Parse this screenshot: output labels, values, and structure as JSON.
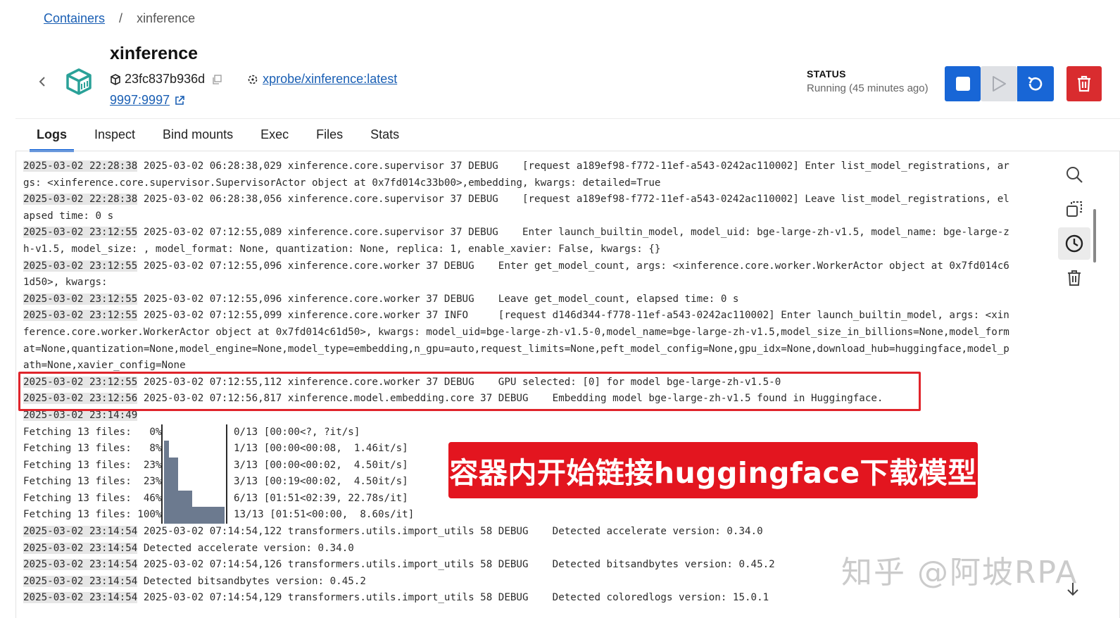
{
  "breadcrumb": {
    "parent": "Containers",
    "separator": "/",
    "current": "xinference"
  },
  "container": {
    "name": "xinference",
    "id": "23fc837b936d",
    "image": "xprobe/xinference:latest",
    "port": "9997:9997"
  },
  "status": {
    "label": "STATUS",
    "value": "Running (45 minutes ago)"
  },
  "tabs": [
    "Logs",
    "Inspect",
    "Bind mounts",
    "Exec",
    "Files",
    "Stats"
  ],
  "active_tab": "Logs",
  "colors": {
    "accent": "#1866d6",
    "danger": "#d92c2f",
    "highlight": "#e0242b",
    "banner": "#e3151f"
  },
  "icons": [
    "chevron-left-icon",
    "container-box-icon",
    "cube-icon",
    "copy-icon",
    "image-icon",
    "external-link-icon",
    "stop-icon",
    "play-icon",
    "restart-icon",
    "trash-icon",
    "search-icon",
    "copy-logs-icon",
    "clock-icon",
    "clear-logs-icon",
    "arrow-down-icon"
  ],
  "logs": [
    {
      "ts": "2025-03-02 22:28:38",
      "text": " 2025-03-02 06:28:38,029 xinference.core.supervisor 37 DEBUG    [request a189ef98-f772-11ef-a543-0242ac110002] Enter list_model_registrations, ar"
    },
    {
      "ts": "",
      "text": "gs: <xinference.core.supervisor.SupervisorActor object at 0x7fd014c33b00>,embedding, kwargs: detailed=True"
    },
    {
      "ts": "2025-03-02 22:28:38",
      "text": " 2025-03-02 06:28:38,056 xinference.core.supervisor 37 DEBUG    [request a189ef98-f772-11ef-a543-0242ac110002] Leave list_model_registrations, el"
    },
    {
      "ts": "",
      "text": "apsed time: 0 s"
    },
    {
      "ts": "2025-03-02 23:12:55",
      "text": " 2025-03-02 07:12:55,089 xinference.core.supervisor 37 DEBUG    Enter launch_builtin_model, model_uid: bge-large-zh-v1.5, model_name: bge-large-z"
    },
    {
      "ts": "",
      "text": "h-v1.5, model_size: , model_format: None, quantization: None, replica: 1, enable_xavier: False, kwargs: {}"
    },
    {
      "ts": "2025-03-02 23:12:55",
      "text": " 2025-03-02 07:12:55,096 xinference.core.worker 37 DEBUG    Enter get_model_count, args: <xinference.core.worker.WorkerActor object at 0x7fd014c6"
    },
    {
      "ts": "",
      "text": "1d50>, kwargs:"
    },
    {
      "ts": "2025-03-02 23:12:55",
      "text": " 2025-03-02 07:12:55,096 xinference.core.worker 37 DEBUG    Leave get_model_count, elapsed time: 0 s"
    },
    {
      "ts": "2025-03-02 23:12:55",
      "text": " 2025-03-02 07:12:55,099 xinference.core.worker 37 INFO     [request d146d344-f778-11ef-a543-0242ac110002] Enter launch_builtin_model, args: <xin"
    },
    {
      "ts": "",
      "text": "ference.core.worker.WorkerActor object at 0x7fd014c61d50>, kwargs: model_uid=bge-large-zh-v1.5-0,model_name=bge-large-zh-v1.5,model_size_in_billions=None,model_form"
    },
    {
      "ts": "",
      "text": "at=None,quantization=None,model_engine=None,model_type=embedding,n_gpu=auto,request_limits=None,peft_model_config=None,gpu_idx=None,download_hub=huggingface,model_p"
    },
    {
      "ts": "",
      "text": "ath=None,xavier_config=None"
    },
    {
      "ts": "2025-03-02 23:12:55",
      "text": " 2025-03-02 07:12:55,112 xinference.core.worker 37 DEBUG    GPU selected: [0] for model bge-large-zh-v1.5-0"
    },
    {
      "ts": "2025-03-02 23:12:56",
      "text": " 2025-03-02 07:12:56,817 xinference.model.embedding.core 37 DEBUG    Embedding model bge-large-zh-v1.5 found in Huggingface."
    },
    {
      "ts": "2025-03-02 23:14:49",
      "text": ""
    }
  ],
  "progress": [
    {
      "label": "Fetching 13 files:   0%",
      "fraction": 0.0,
      "tail": " 0/13 [00:00<?, ?it/s]"
    },
    {
      "label": "Fetching 13 files:   8%",
      "fraction": 0.08,
      "tail": " 1/13 [00:00<00:08,  1.46it/s]"
    },
    {
      "label": "Fetching 13 files:  23%",
      "fraction": 0.23,
      "tail": " 3/13 [00:00<00:02,  4.50it/s]"
    },
    {
      "label": "Fetching 13 files:  23%",
      "fraction": 0.23,
      "tail": " 3/13 [00:19<00:02,  4.50it/s]"
    },
    {
      "label": "Fetching 13 files:  46%",
      "fraction": 0.46,
      "tail": " 6/13 [01:51<02:39, 22.78s/it]"
    },
    {
      "label": "Fetching 13 files: 100%",
      "fraction": 1.0,
      "tail": " 13/13 [01:51<00:00,  8.60s/it]"
    }
  ],
  "logs_after": [
    {
      "ts": "2025-03-02 23:14:54",
      "text": " 2025-03-02 07:14:54,122 transformers.utils.import_utils 58 DEBUG    Detected accelerate version: 0.34.0"
    },
    {
      "ts": "2025-03-02 23:14:54",
      "text": " Detected accelerate version: 0.34.0"
    },
    {
      "ts": "2025-03-02 23:14:54",
      "text": " 2025-03-02 07:14:54,126 transformers.utils.import_utils 58 DEBUG    Detected bitsandbytes version: 0.45.2"
    },
    {
      "ts": "2025-03-02 23:14:54",
      "text": " Detected bitsandbytes version: 0.45.2"
    },
    {
      "ts": "2025-03-02 23:14:54",
      "text": " 2025-03-02 07:14:54,129 transformers.utils.import_utils 58 DEBUG    Detected coloredlogs version: 15.0.1"
    }
  ],
  "annotation_banner": "容器内开始链接huggingface下载模型",
  "watermark": "知乎 @阿坡RPA"
}
